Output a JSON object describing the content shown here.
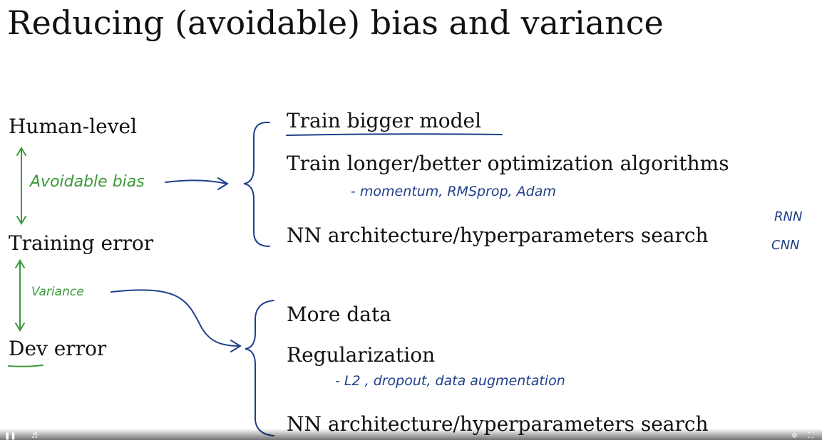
{
  "slide": {
    "title": "Reducing (avoidable) bias and variance",
    "levels": {
      "human_level": "Human-level",
      "training_error": "Training error",
      "dev_error": "Dev error"
    },
    "bias_options": [
      "Train bigger model",
      "Train longer/better optimization algorithms",
      "NN architecture/hyperparameters search"
    ],
    "variance_options": [
      "More data",
      "Regularization",
      "NN architecture/hyperparameters search"
    ]
  },
  "annotations": {
    "avoidable_bias": "Avoidable bias",
    "variance": "Variance",
    "optimizers": "- momentum, RMSprop, Adam",
    "rnn": "RNN",
    "cnn": "CNN",
    "regularization_methods": "- L2 , dropout, data augmentation"
  },
  "colors": {
    "handwriting_green": "#3a9a3a",
    "handwriting_blue": "#1f3f8a",
    "text": "#111111",
    "background": "#ffffff"
  },
  "video_controls": {
    "icons": [
      "pause-icon",
      "volume-icon",
      "settings-icon",
      "fullscreen-icon"
    ]
  }
}
